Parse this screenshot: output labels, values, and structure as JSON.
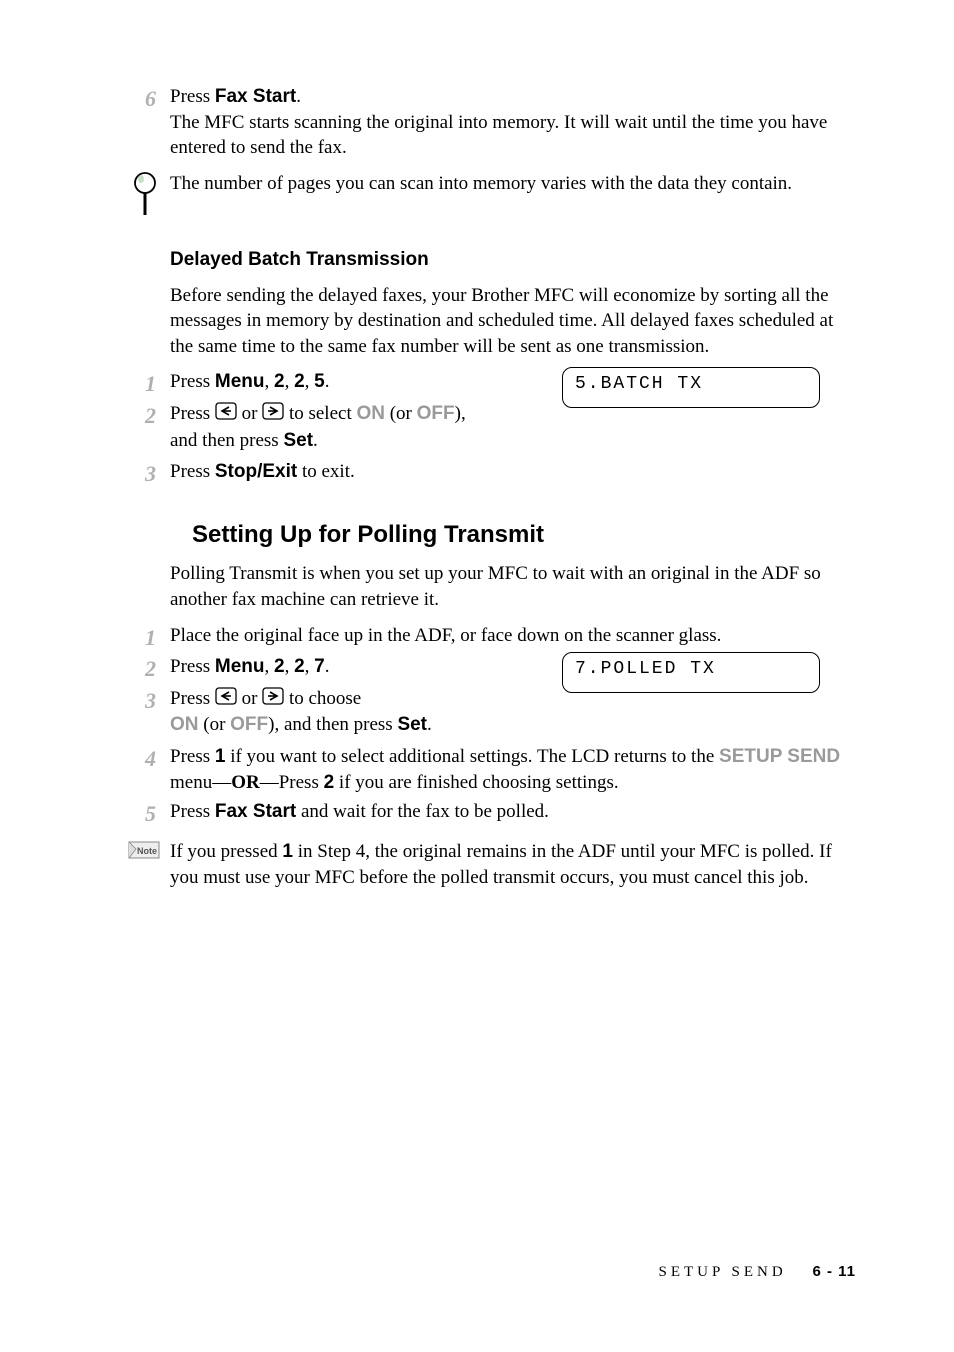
{
  "step6": {
    "num": "6",
    "a": "Press ",
    "b": "Fax Start",
    "c": ".",
    "d": "The MFC starts scanning the original into memory. It will wait until the time you have entered to send the fax."
  },
  "magnify_note": "The number of pages you can scan into memory varies with the data they contain.",
  "delayed": {
    "heading": "Delayed Batch Transmission",
    "intro": "Before sending the delayed faxes, your Brother MFC will economize by sorting all the messages in memory by destination and scheduled time. All delayed faxes scheduled at the same time to the same fax number will be sent as one transmission.",
    "s1": {
      "num": "1",
      "a": "Press ",
      "b": "Menu",
      "c": ", ",
      "d": "2",
      "e": ", ",
      "f": "2",
      "g": ", ",
      "h": "5",
      "i": "."
    },
    "s2": {
      "num": "2",
      "a": "Press  ",
      "b": "  or  ",
      "c": "  to select ",
      "on": "ON",
      "d": " (or ",
      "off": "OFF",
      "e": "),",
      "f": "and then press ",
      "set": "Set",
      "g": "."
    },
    "s3": {
      "num": "3",
      "a": "Press ",
      "b": "Stop/Exit",
      "c": " to exit."
    },
    "lcd": "5.BATCH TX"
  },
  "polling": {
    "heading": "Setting Up for Polling Transmit",
    "intro": "Polling Transmit is when you set up your MFC to wait with an original in the ADF so another fax machine can retrieve it.",
    "s1": {
      "num": "1",
      "a": "Place the original face up in the ADF, or face down on the scanner glass."
    },
    "s2": {
      "num": "2",
      "a": "Press ",
      "b": "Menu",
      "c": ", ",
      "d": "2",
      "e": ", ",
      "f": "2",
      "g": ", ",
      "h": "7",
      "i": "."
    },
    "s3": {
      "num": "3",
      "a": "Press  ",
      "b": "  or  ",
      "c": "  to choose",
      "on": "ON",
      "d": " (or ",
      "off": "OFF",
      "e": "), and then press ",
      "set": "Set",
      "f": "."
    },
    "s4": {
      "num": "4",
      "a": "Press ",
      "one": "1",
      "b": " if you want to select additional settings. The LCD returns to the ",
      "setup": "SETUP SEND",
      "c": " menu—",
      "or": "OR",
      "d": "—Press ",
      "two": "2",
      "e": " if you are finished choosing settings."
    },
    "s5": {
      "num": "5",
      "a": "Press ",
      "b": "Fax Start",
      "c": " and wait for the fax to be polled."
    },
    "lcd": "7.POLLED TX"
  },
  "note": {
    "a": "If you pressed ",
    "one": "1",
    "b": " in Step 4, the original remains in the ADF until your MFC is polled. If you must use your MFC before the polled transmit occurs, you must cancel this job."
  },
  "note_icon_label": "Note",
  "footer": {
    "section": "SETUP SEND",
    "page": "6 - 11"
  }
}
